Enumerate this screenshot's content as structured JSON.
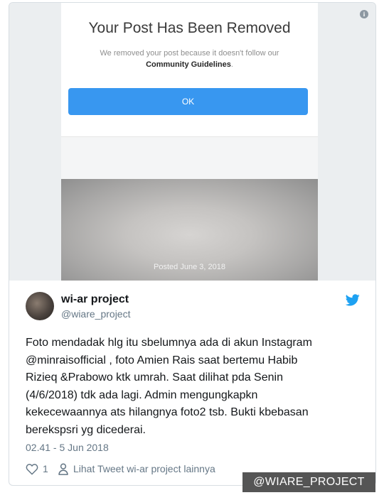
{
  "instagram": {
    "title": "Your Post Has Been Removed",
    "message": "We removed your post because it doesn't follow our",
    "guidelines_link": "Community Guidelines",
    "period": ".",
    "ok_label": "OK",
    "posted_date": "Posted June 3, 2018"
  },
  "tweet": {
    "author_name": "wi-ar project",
    "author_handle": "@wiare_project",
    "text": "Foto mendadak hlg itu sbelumnya ada di akun Instagram\n@minraisofficial , foto Amien Rais saat bertemu Habib\nRizieq &Prabowo ktk umrah. Saat dilihat pda Senin\n(4/6/2018) tdk ada lagi. Admin mengungkapkn\nkekecewaannya ats hilangnya foto2 tsb. Bukti kbebasan\nberekspsri yg dicederai.",
    "timestamp": "02.41 - 5 Jun 2018",
    "like_count": "1",
    "more_link": "Lihat Tweet wi-ar project lainnya"
  },
  "info_icon": "i",
  "watermark": "@WIARE_PROJECT",
  "icons": [
    "info-icon",
    "twitter-bird-icon",
    "heart-icon",
    "person-icon"
  ],
  "colors": {
    "ok_button": "#3897f0",
    "twitter_blue": "#1da1f2",
    "muted": "#657786"
  }
}
